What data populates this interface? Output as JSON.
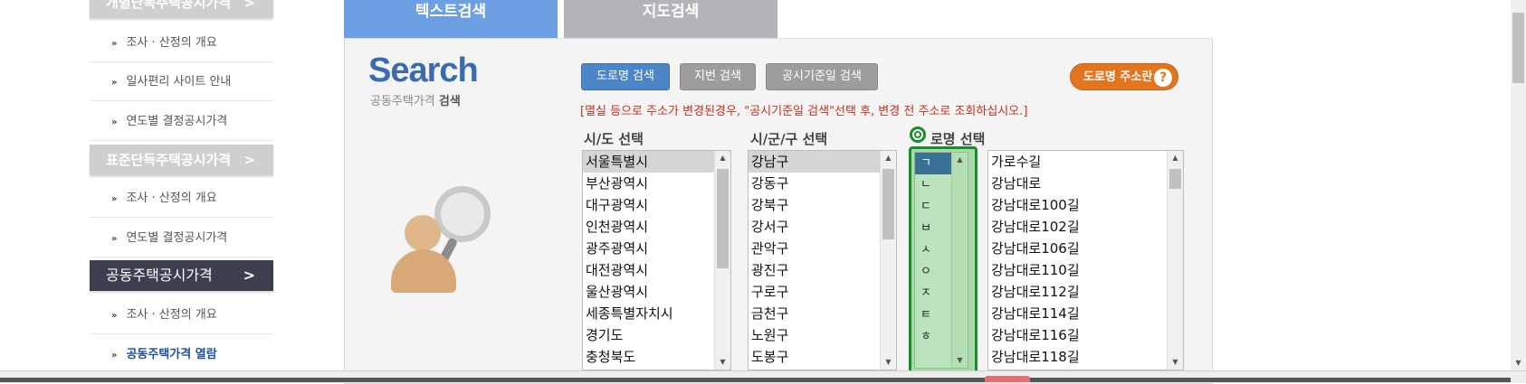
{
  "sidebar": {
    "top_header": "개별단독주택공시가격",
    "sections": [
      {
        "items": [
          "조사 · 산정의 개요",
          "일사편리 사이트 안내",
          "연도별 결정공시가격"
        ]
      },
      {
        "header": "표준단독주택공시가격",
        "items": [
          "조사 · 산정의 개요",
          "연도별 결정공시가격"
        ]
      },
      {
        "header": "공동주택공시가격",
        "items": [
          "조사 · 산정의 개요",
          "공동주택가격 열람"
        ]
      }
    ]
  },
  "tabs": {
    "text_search": "텍스트검색",
    "map_search": "지도검색"
  },
  "logo": {
    "title": "Search",
    "sub_plain": "공동주택가격 ",
    "sub_bold": "검색"
  },
  "buttons": {
    "road": "도로명 검색",
    "lot": "지번 검색",
    "date": "공시기준일 검색",
    "road_info": "도로명 주소란"
  },
  "notice": "[멸실 등으로 주소가 변경된경우, \"공시기준일 검색\"선택 후, 변경 전 주소로 조회하십시오.]",
  "labels": {
    "sido": "시/도 선택",
    "sigungu": "시/군/구 선택",
    "road": "로명 선택"
  },
  "sido_options": [
    "서울특별시",
    "부산광역시",
    "대구광역시",
    "인천광역시",
    "광주광역시",
    "대전광역시",
    "울산광역시",
    "세종특별자치시",
    "경기도",
    "충청북도"
  ],
  "sigungu_options": [
    "강남구",
    "강동구",
    "강북구",
    "강서구",
    "관악구",
    "광진구",
    "구로구",
    "금천구",
    "노원구",
    "도봉구"
  ],
  "consonants": [
    "ㄱ",
    "ㄴ",
    "ㄷ",
    "ㅂ",
    "ㅅ",
    "ㅇ",
    "ㅈ",
    "ㅌ",
    "ㅎ"
  ],
  "road_options": [
    "가로수길",
    "강남대로",
    "강남대로100길",
    "강남대로102길",
    "강남대로106길",
    "강남대로110길",
    "강남대로112길",
    "강남대로114길",
    "강남대로116길",
    "강남대로118길"
  ],
  "colors": {
    "tab_active": "#6d9fe3",
    "tab_inactive": "#b4b4b8",
    "accent_orange": "#e2761f",
    "highlight_green": "#1a8c2a"
  }
}
